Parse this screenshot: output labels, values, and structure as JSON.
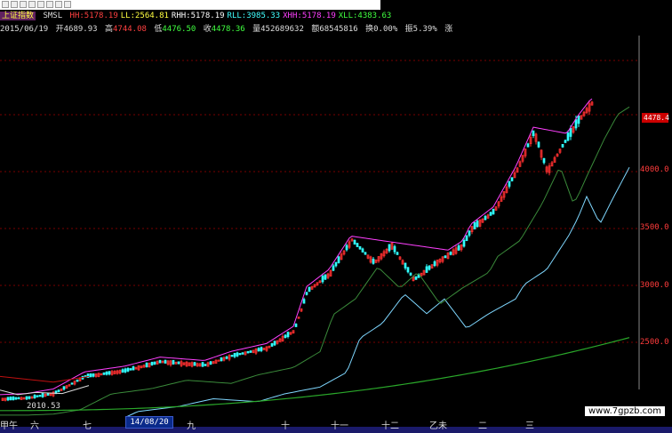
{
  "row1": {
    "index_name": "上证指数",
    "indicator": "SMSL",
    "items": [
      {
        "label": "HH:",
        "value": "5178.19",
        "color": "#ff4040"
      },
      {
        "label": "LL:",
        "value": "2564.81",
        "color": "#ffff40"
      },
      {
        "label": "RHH:",
        "value": "5178.19",
        "color": "#ffffff"
      },
      {
        "label": "RLL:",
        "value": "3985.33",
        "color": "#40ffff"
      },
      {
        "label": "XHH:",
        "value": "5178.19",
        "color": "#ff40ff"
      },
      {
        "label": "XLL:",
        "value": "4383.63",
        "color": "#40ff40"
      }
    ]
  },
  "row2": {
    "date": "2015/06/19",
    "open_label": "开",
    "open": "4689.93",
    "high_label": "高",
    "high": "4744.08",
    "low_label": "低",
    "low": "4476.50",
    "close_label": "收",
    "close": "4478.36",
    "volume_label": "量",
    "volume": "452689632",
    "amount_label": "额",
    "amount": "68545816",
    "turnover_label": "换",
    "turnover": "0.00%",
    "amplitude_label": "振",
    "amplitude": "5.39%",
    "change_label": "涨"
  },
  "yaxis": {
    "ticks": [
      "4000.0",
      "3500.0",
      "3000.0",
      "2500.0"
    ],
    "price_tag": "4478.4"
  },
  "xaxis": {
    "labels": [
      "甲午",
      "六",
      "七",
      "九",
      "十",
      "十一",
      "十二",
      "乙未",
      "二",
      "三"
    ],
    "date_box": "14/08/20"
  },
  "annotation": "2010.53",
  "watermark": "www.7gpzb.com",
  "colors": {
    "up": "#ff3030",
    "down": "#30ffff",
    "hh": "#ff40ff",
    "rll": "#7fd7ff",
    "xll": "#3a8a3a",
    "ll": "#2aa82a",
    "gridline": "#7a0000"
  }
}
